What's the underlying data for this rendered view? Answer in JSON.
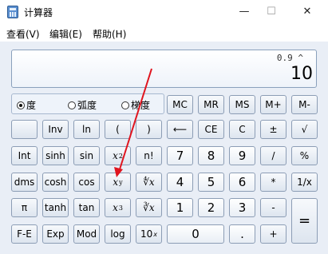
{
  "window": {
    "title": "计算器",
    "minimize": "—",
    "maximize": "☐",
    "close": "✕"
  },
  "menu": [
    "查看(V)",
    "编辑(E)",
    "帮助(H)"
  ],
  "display": {
    "expression": "0.9 ^",
    "value": "10"
  },
  "angle_units": [
    {
      "label": "度",
      "selected": true
    },
    {
      "label": "弧度",
      "selected": false
    },
    {
      "label": "梯度",
      "selected": false
    }
  ],
  "memory": [
    "MC",
    "MR",
    "MS",
    "M+",
    "M-"
  ],
  "buttons": {
    "inv": "Inv",
    "ln": "ln",
    "lparen": "(",
    "rparen": ")",
    "back": "⟵",
    "ce": "CE",
    "c": "C",
    "sign": "±",
    "sqrt": "√",
    "int": "Int",
    "sinh": "sinh",
    "sin": "sin",
    "x2": "x",
    "x2_sup": "2",
    "fact": "n!",
    "n7": "7",
    "n8": "8",
    "n9": "9",
    "div": "/",
    "pct": "%",
    "dms": "dms",
    "cosh": "cosh",
    "cos": "cos",
    "xy": "x",
    "xy_sup": "y",
    "yroot": "∜x",
    "n4": "4",
    "n5": "5",
    "n6": "6",
    "mul": "*",
    "recip": "1/x",
    "pi": "π",
    "tanh": "tanh",
    "tan": "tan",
    "x3": "x",
    "x3_sup": "3",
    "cbrt": "∛x",
    "n1": "1",
    "n2": "2",
    "n3": "3",
    "sub": "-",
    "eq": "=",
    "fe": "F-E",
    "exp": "Exp",
    "mod": "Mod",
    "log": "log",
    "tenx": "10",
    "tenx_sup": "x",
    "n0": "0",
    "dot": ".",
    "add": "+"
  },
  "colors": {
    "arrow": "#e0141e"
  }
}
